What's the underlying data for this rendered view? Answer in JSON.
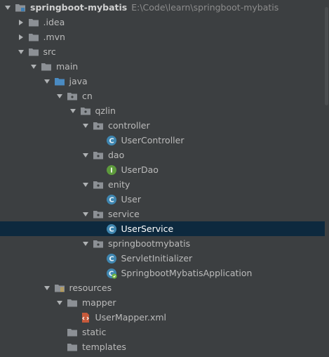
{
  "tree": {
    "root": {
      "name": "springboot-mybatis",
      "path": "E:\\Code\\learn\\springboot-mybatis"
    },
    "items": [
      {
        "label": "springboot-mybatis",
        "depth": 0,
        "arrow": "down",
        "icon": "module-folder-icon"
      },
      {
        "label": ".idea",
        "depth": 1,
        "arrow": "right",
        "icon": "folder-icon"
      },
      {
        "label": ".mvn",
        "depth": 1,
        "arrow": "right",
        "icon": "folder-icon"
      },
      {
        "label": "src",
        "depth": 1,
        "arrow": "down",
        "icon": "folder-icon"
      },
      {
        "label": "main",
        "depth": 2,
        "arrow": "down",
        "icon": "folder-icon"
      },
      {
        "label": "java",
        "depth": 3,
        "arrow": "down",
        "icon": "source-folder-icon"
      },
      {
        "label": "cn",
        "depth": 4,
        "arrow": "down",
        "icon": "package-icon"
      },
      {
        "label": "qzlin",
        "depth": 5,
        "arrow": "down",
        "icon": "package-icon"
      },
      {
        "label": "controller",
        "depth": 6,
        "arrow": "down",
        "icon": "package-icon"
      },
      {
        "label": "UserController",
        "depth": 7,
        "arrow": "none",
        "icon": "class-icon"
      },
      {
        "label": "dao",
        "depth": 6,
        "arrow": "down",
        "icon": "package-icon"
      },
      {
        "label": "UserDao",
        "depth": 7,
        "arrow": "none",
        "icon": "interface-icon"
      },
      {
        "label": "enity",
        "depth": 6,
        "arrow": "down",
        "icon": "package-icon"
      },
      {
        "label": "User",
        "depth": 7,
        "arrow": "none",
        "icon": "class-icon"
      },
      {
        "label": "service",
        "depth": 6,
        "arrow": "down",
        "icon": "package-icon"
      },
      {
        "label": "UserService",
        "depth": 7,
        "arrow": "none",
        "icon": "class-icon",
        "selected": true
      },
      {
        "label": "springbootmybatis",
        "depth": 6,
        "arrow": "down",
        "icon": "package-icon"
      },
      {
        "label": "ServletInitializer",
        "depth": 7,
        "arrow": "none",
        "icon": "class-icon"
      },
      {
        "label": "SpringbootMybatisApplication",
        "depth": 7,
        "arrow": "none",
        "icon": "spring-boot-class-icon"
      },
      {
        "label": "resources",
        "depth": 3,
        "arrow": "down",
        "icon": "resources-folder-icon"
      },
      {
        "label": "mapper",
        "depth": 4,
        "arrow": "down",
        "icon": "folder-icon"
      },
      {
        "label": "UserMapper.xml",
        "depth": 5,
        "arrow": "none",
        "icon": "xml-file-icon"
      },
      {
        "label": "static",
        "depth": 4,
        "arrow": "none",
        "icon": "folder-icon"
      },
      {
        "label": "templates",
        "depth": 4,
        "arrow": "none",
        "icon": "folder-icon"
      }
    ]
  },
  "colors": {
    "background": "#3c3f41",
    "selection": "#0d293e",
    "text": "#bbbbbb",
    "folder": "#8c9095",
    "source_folder": "#4a8bc2",
    "class_badge": "#3f86b0",
    "interface_badge": "#5d9a3c",
    "resources_stripes": "#c9a346"
  }
}
